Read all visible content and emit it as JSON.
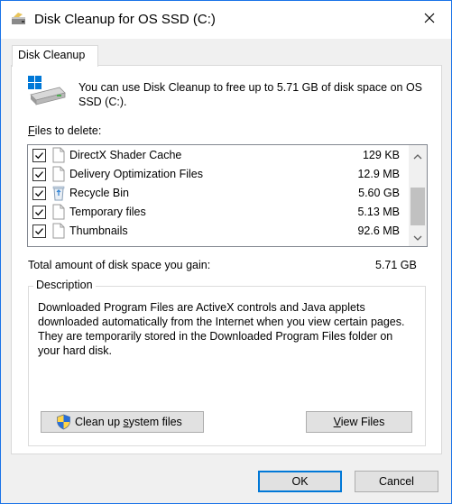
{
  "window": {
    "title": "Disk Cleanup for OS SSD (C:)"
  },
  "tab": {
    "label": "Disk Cleanup"
  },
  "intro_text": "You can use Disk Cleanup to free up to 5.71 GB of disk space on OS SSD (C:).",
  "files_label_prefix": "F",
  "files_label_rest": "iles to delete:",
  "files": [
    {
      "name": "DirectX Shader Cache",
      "size": "129 KB",
      "checked": true,
      "icon": "file-icon"
    },
    {
      "name": "Delivery Optimization Files",
      "size": "12.9 MB",
      "checked": true,
      "icon": "file-icon"
    },
    {
      "name": "Recycle Bin",
      "size": "5.60 GB",
      "checked": true,
      "icon": "recycle-bin-icon"
    },
    {
      "name": "Temporary files",
      "size": "5.13 MB",
      "checked": true,
      "icon": "file-icon"
    },
    {
      "name": "Thumbnails",
      "size": "92.6 MB",
      "checked": true,
      "icon": "file-icon"
    }
  ],
  "total": {
    "label": "Total amount of disk space you gain:",
    "value": "5.71 GB"
  },
  "description": {
    "legend": "Description",
    "text": "Downloaded Program Files are ActiveX controls and Java applets downloaded automatically from the Internet when you view certain pages. They are temporarily stored in the Downloaded Program Files folder on your hard disk."
  },
  "buttons": {
    "cleanup_prefix": "Clean up ",
    "cleanup_underlined": "s",
    "cleanup_suffix": "ystem files",
    "view_underlined": "V",
    "view_suffix": "iew Files",
    "ok": "OK",
    "cancel": "Cancel"
  },
  "colors": {
    "accent": "#0078d7",
    "window_border": "#1a73e8"
  }
}
